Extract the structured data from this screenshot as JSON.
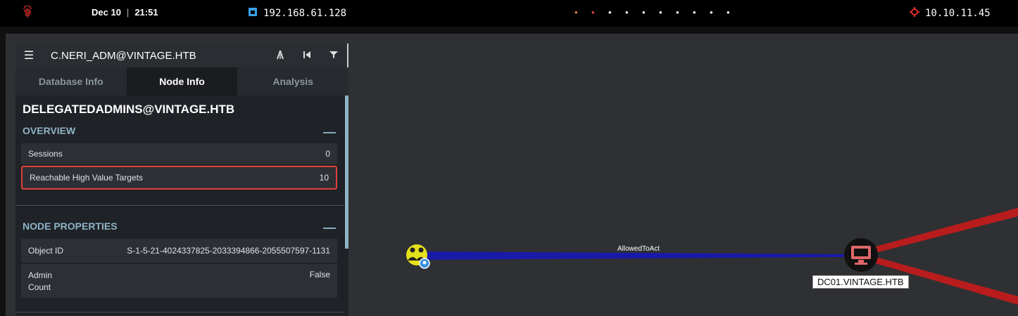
{
  "topbar": {
    "date": "Dec 10",
    "time": "21:51",
    "local_ip": "192.168.61.128",
    "workspaces": [
      "•",
      "•",
      "•",
      "•",
      "•",
      "•",
      "•",
      "•",
      "•",
      "•"
    ],
    "target_ip": "10.10.11.45"
  },
  "panel": {
    "search_value": "C.NERI_ADM@VINTAGE.HTB",
    "tabs": [
      "Database Info",
      "Node Info",
      "Analysis"
    ],
    "active_tab": "Node Info",
    "node_name": "DELEGATEDADMINS@VINTAGE.HTB",
    "overview": {
      "heading": "OVERVIEW",
      "collapse_symbol": "—",
      "rows": [
        {
          "label": "Sessions",
          "value": "0"
        },
        {
          "label": "Reachable High Value Targets",
          "value": "10"
        }
      ]
    },
    "node_properties": {
      "heading": "NODE PROPERTIES",
      "collapse_symbol": "—",
      "rows": [
        {
          "label": "Object ID",
          "value": "S-1-5-21-4024337825-2033394866-2055507597-1131"
        },
        {
          "label": "Admin Count",
          "value": "False"
        }
      ]
    }
  },
  "graph": {
    "edge_label": "AllowedToAct",
    "target_node_label": "DC01.VINTAGE.HTB",
    "colors": {
      "edge_primary": "#1a1aa8",
      "edge_secondary": "#b81c1c",
      "group_node": "#e4e01a",
      "computer_node": "#e06868"
    }
  }
}
